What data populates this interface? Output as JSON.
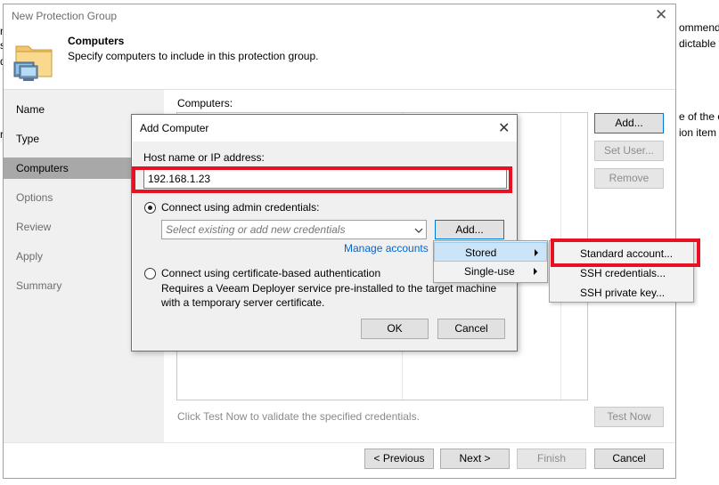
{
  "background": {
    "right_fragments": [
      "ommend",
      "dictable t",
      "e of the o",
      "ion item"
    ],
    "left_fragments": [
      "n",
      "sc",
      "d",
      "re"
    ]
  },
  "window": {
    "title": "New Protection Group",
    "header_title": "Computers",
    "header_subtitle": "Specify computers to include in this protection group.",
    "icon": "computer-folder-icon"
  },
  "nav": {
    "items": [
      {
        "label": "Name"
      },
      {
        "label": "Type"
      },
      {
        "label": "Computers"
      },
      {
        "label": "Options"
      },
      {
        "label": "Review"
      },
      {
        "label": "Apply"
      },
      {
        "label": "Summary"
      }
    ]
  },
  "main": {
    "computers_label": "Computers:",
    "add_button": "Add...",
    "set_user_button": "Set User...",
    "remove_button": "Remove",
    "hint": "Click Test Now to validate the specified credentials.",
    "test_now_button": "Test Now"
  },
  "footer": {
    "previous": "< Previous",
    "next": "Next >",
    "finish": "Finish",
    "cancel": "Cancel"
  },
  "dialog": {
    "title": "Add Computer",
    "host_label": "Host name or IP address:",
    "host_value": "192.168.1.23",
    "radio_admin_label": "Connect using admin credentials:",
    "credentials_placeholder": "Select existing or add new credentials",
    "add_button": "Add...",
    "manage_accounts": "Manage accounts",
    "radio_cert_label": "Connect using certificate-based authentication",
    "cert_description_line1": "Requires a Veeam Deployer service pre-installed to the target machine",
    "cert_description_line2": "with a temporary server certificate.",
    "ok": "OK",
    "cancel": "Cancel"
  },
  "menu": {
    "items": [
      {
        "label": "Stored"
      },
      {
        "label": "Single-use"
      }
    ]
  },
  "submenu": {
    "items": [
      {
        "label": "Standard account..."
      },
      {
        "label": "SSH credentials..."
      },
      {
        "label": "SSH private key..."
      }
    ]
  },
  "colors": {
    "highlight_box": "#e81123",
    "link": "#0066cc",
    "nav_active": "#a8a8a8",
    "menu_highlight": "#cce4f7"
  }
}
